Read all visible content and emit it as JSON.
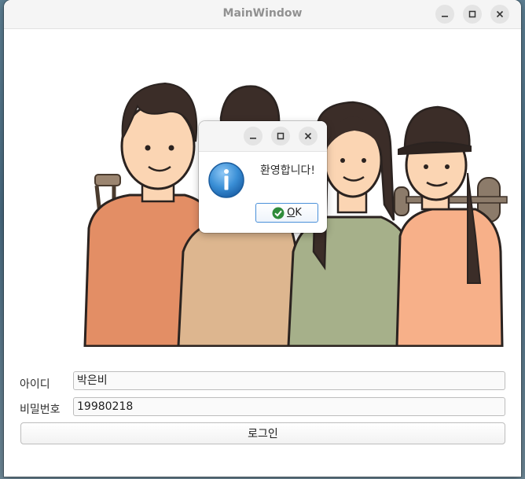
{
  "window": {
    "title": "MainWindow"
  },
  "form": {
    "id_label": "아이디",
    "id_value": "박은비",
    "password_label": "비밀번호",
    "password_value": "19980218",
    "login_button": "로그인"
  },
  "dialog": {
    "message": "환영합니다!",
    "ok_mnemonic": "O",
    "ok_rest": "K",
    "icon": "information-icon"
  },
  "colors": {
    "accent": "#4a90d9",
    "info_icon": "#3a8fd6",
    "ok_check": "#2e8b3a"
  }
}
